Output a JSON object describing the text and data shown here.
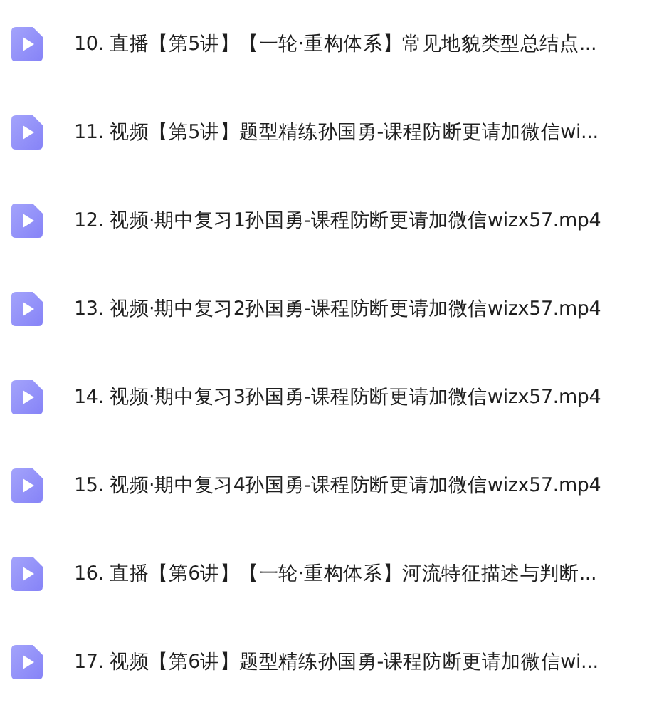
{
  "files": [
    {
      "name": "10. 直播【第5讲】【一轮·重构体系】常见地貌类型总结点..."
    },
    {
      "name": "11. 视频【第5讲】题型精练孙国勇-课程防断更请加微信wi..."
    },
    {
      "name": "12. 视频·期中复习1孙国勇-课程防断更请加微信wizx57.mp4"
    },
    {
      "name": "13. 视频·期中复习2孙国勇-课程防断更请加微信wizx57.mp4"
    },
    {
      "name": "14. 视频·期中复习3孙国勇-课程防断更请加微信wizx57.mp4"
    },
    {
      "name": "15. 视频·期中复习4孙国勇-课程防断更请加微信wizx57.mp4"
    },
    {
      "name": "16. 直播【第6讲】【一轮·重构体系】河流特征描述与判断..."
    },
    {
      "name": "17. 视频【第6讲】题型精练孙国勇-课程防断更请加微信wi..."
    }
  ]
}
